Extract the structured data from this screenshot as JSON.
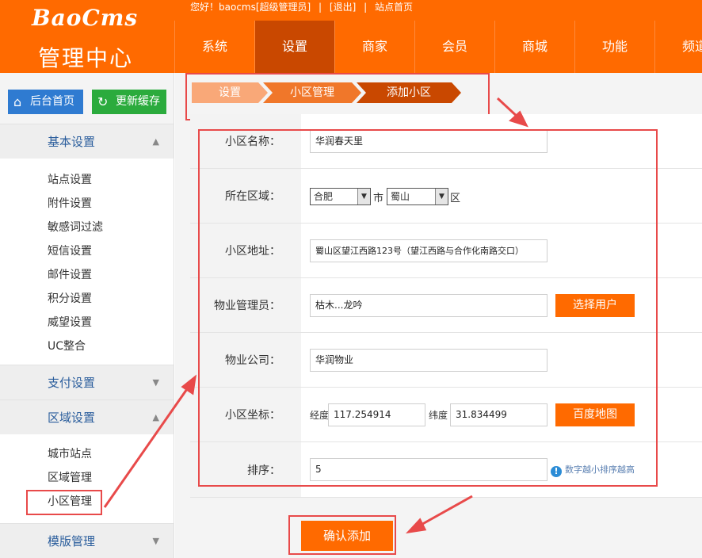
{
  "header": {
    "logo": "BaoCms",
    "subtitle": "管理中心",
    "topbar": {
      "greeting": "您好！baocms[超级管理员]",
      "sep1": "|",
      "logout": "[退出]",
      "sep2": "|",
      "site_home": "站点首页"
    },
    "nav": [
      "系统",
      "设置",
      "商家",
      "会员",
      "商城",
      "功能",
      "频道"
    ],
    "active_nav": "设置"
  },
  "sidebar": {
    "home_button": "后台首页",
    "refresh_button": "更新缓存",
    "groups": [
      {
        "label": "基本设置",
        "arrow": "▲",
        "items": [
          "站点设置",
          "附件设置",
          "敏感词过滤",
          "短信设置",
          "邮件设置",
          "积分设置",
          "威望设置",
          "UC整合"
        ]
      },
      {
        "label": "支付设置",
        "arrow": "▼",
        "items": []
      },
      {
        "label": "区域设置",
        "arrow": "▲",
        "items": [
          "城市站点",
          "区域管理",
          "小区管理"
        ]
      },
      {
        "label": "模版管理",
        "arrow": "▼",
        "items": []
      }
    ]
  },
  "breadcrumb": [
    "设置",
    "小区管理",
    "添加小区"
  ],
  "form": {
    "name_label": "小区名称：",
    "name_value": "华润春天里",
    "area_label": "所在区域：",
    "city_value": "合肥",
    "city_suffix": "市",
    "district_value": "蜀山",
    "district_suffix": "区",
    "address_label": "小区地址：",
    "address_value": "蜀山区望江西路123号（望江西路与合作化南路交口）",
    "manager_label": "物业管理员：",
    "manager_value": "枯木...龙吟",
    "choose_user_button": "选择用户",
    "company_label": "物业公司：",
    "company_value": "华润物业",
    "coord_label": "小区坐标：",
    "lng_label": "经度",
    "lng_value": "117.254914",
    "lat_label": "纬度",
    "lat_value": "31.834499",
    "map_button": "百度地图",
    "order_label": "排序：",
    "order_value": "5",
    "order_hint": "数字越小排序越高",
    "submit_button": "确认添加"
  },
  "colors": {
    "brand": "#ff6a00",
    "nav_active": "#c94800",
    "annotation": "#e84a4a"
  }
}
